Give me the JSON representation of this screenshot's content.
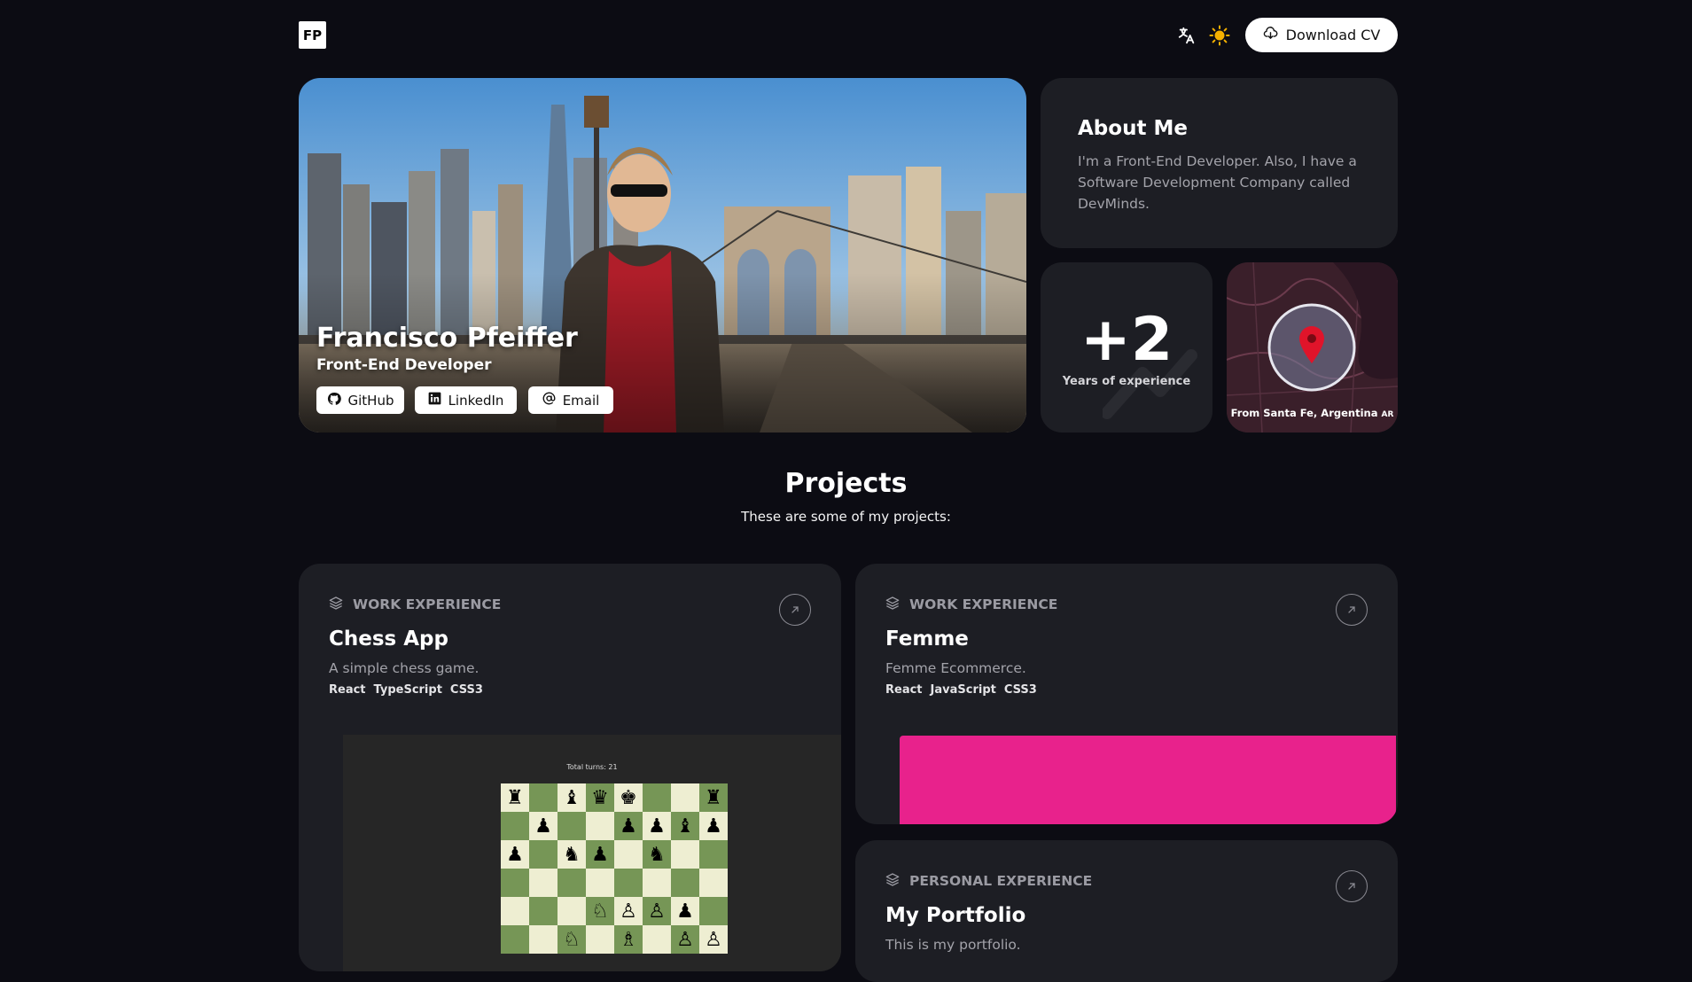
{
  "header": {
    "logo": "FP",
    "download_cv_label": "Download CV"
  },
  "hero": {
    "name": "Francisco Pfeiffer",
    "role": "Front-End Developer",
    "links": [
      {
        "label": "GitHub",
        "icon": "github-icon"
      },
      {
        "label": "LinkedIn",
        "icon": "linkedin-icon"
      },
      {
        "label": "Email",
        "icon": "at-icon"
      }
    ]
  },
  "about": {
    "title": "About Me",
    "text": "I'm a Front-End Developer. Also, I have a Software Development Company called DevMinds."
  },
  "experience": {
    "value": "+2",
    "label": "Years of experience"
  },
  "location": {
    "label": "From Santa Fe, Argentina",
    "flag": "AR"
  },
  "projects": {
    "title": "Projects",
    "subtitle": "These are some of my projects:",
    "items": [
      {
        "badge": "WORK EXPERIENCE",
        "title": "Chess App",
        "description": "A simple chess game.",
        "tags": [
          "React",
          "TypeScript",
          "CSS3"
        ],
        "preview_caption": "Total turns: 21"
      },
      {
        "badge": "WORK EXPERIENCE",
        "title": "Femme",
        "description": "Femme Ecommerce.",
        "tags": [
          "React",
          "JavaScript",
          "CSS3"
        ],
        "preview_color": "#e8228c"
      },
      {
        "badge": "PERSONAL EXPERIENCE",
        "title": "My Portfolio",
        "description": "This is my portfolio."
      }
    ]
  },
  "colors": {
    "background": "#0c0c13",
    "card": "#1d1e24",
    "accent_sun": "#f5b100",
    "femme_pink": "#e8228c"
  }
}
